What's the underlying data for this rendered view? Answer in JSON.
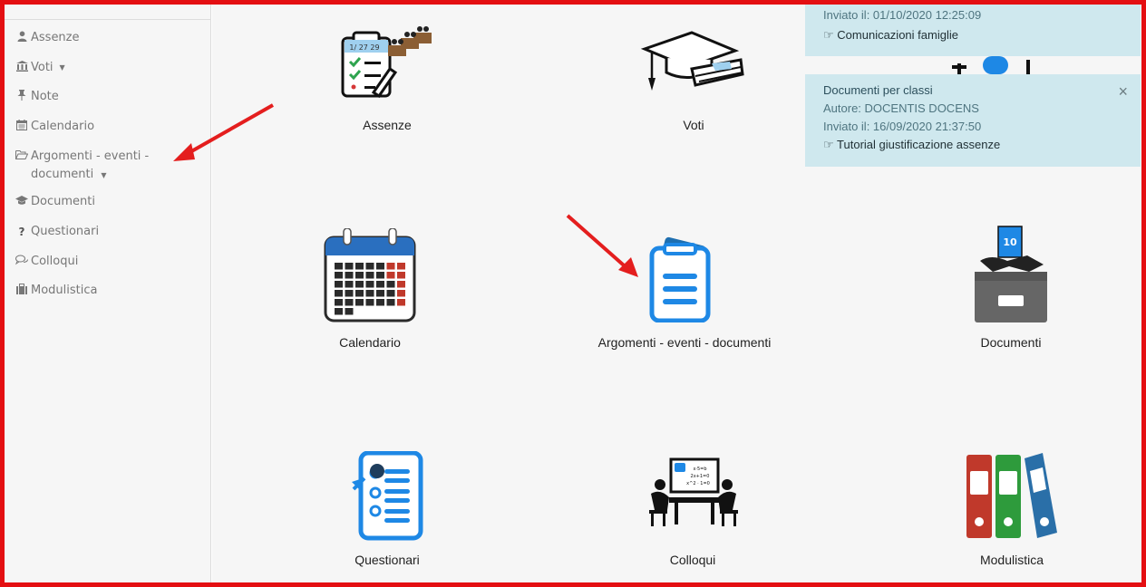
{
  "sidebar": {
    "items": [
      {
        "label": "Assenze",
        "icon": "user-icon",
        "caret": false
      },
      {
        "label": "Voti",
        "icon": "bank-icon",
        "caret": true
      },
      {
        "label": "Note",
        "icon": "pushpin-icon",
        "caret": false
      },
      {
        "label": "Calendario",
        "icon": "calendar-icon",
        "caret": false
      },
      {
        "label": "Argomenti - eventi -",
        "label2": "documenti",
        "icon": "folder-open-icon",
        "caret": true
      },
      {
        "label": "Documenti",
        "icon": "graduation-cap-icon",
        "caret": false
      },
      {
        "label": "Questionari",
        "icon": "question-icon",
        "caret": false
      },
      {
        "label": "Colloqui",
        "icon": "comments-icon",
        "caret": false
      },
      {
        "label": "Modulistica",
        "icon": "briefcase-icon",
        "caret": false
      }
    ]
  },
  "tiles": [
    {
      "label": "Assenze",
      "icon": "attendance-clipboard-icon"
    },
    {
      "label": "Voti",
      "icon": "graduation-cap-diploma-icon"
    },
    {
      "label": "Calendario",
      "icon": "calendar-grid-icon"
    },
    {
      "label": "Argomenti - eventi - documenti",
      "icon": "event-document-icon"
    },
    {
      "label": "Documenti",
      "icon": "document-archive-box-icon"
    },
    {
      "label": "Questionari",
      "icon": "questionnaire-icon"
    },
    {
      "label": "Colloqui",
      "icon": "meeting-blackboard-icon"
    },
    {
      "label": "Modulistica",
      "icon": "binders-icon"
    }
  ],
  "notices": [
    {
      "sent": "Inviato il: 01/10/2020 12:25:09",
      "link": "Comunicazioni famiglie"
    },
    {
      "title": "Documenti per classi",
      "author": "Autore: DOCENTIS DOCENS",
      "sent": "Inviato il: 16/09/2020 21:37:50",
      "link": "Tutorial giustificazione assenze",
      "close": "×"
    }
  ],
  "colors": {
    "frame": "#e40f12",
    "notice_bg": "#cfe8ee",
    "icon_blue": "#2196f3",
    "calendar_red": "#c0392b"
  }
}
